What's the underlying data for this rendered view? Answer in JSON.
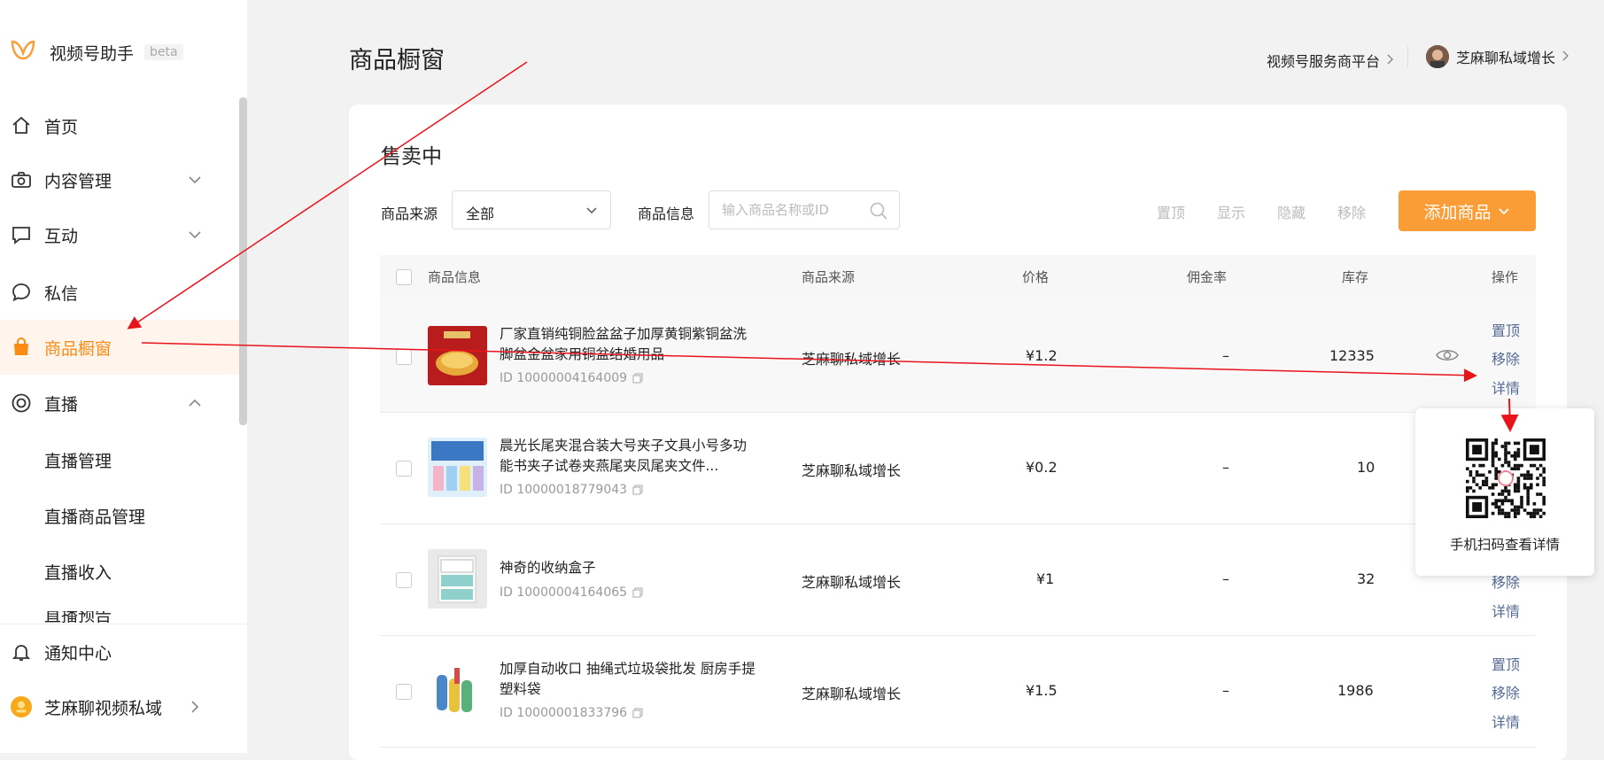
{
  "brand": {
    "name": "视频号助手",
    "badge": "beta"
  },
  "sidebar": {
    "items": [
      {
        "label": "首页",
        "icon": "home-icon"
      },
      {
        "label": "内容管理",
        "icon": "camera-icon"
      },
      {
        "label": "互动",
        "icon": "comment-icon"
      },
      {
        "label": "私信",
        "icon": "message-icon"
      },
      {
        "label": "商品橱窗",
        "icon": "shopping-bag-icon",
        "active": true
      },
      {
        "label": "直播",
        "icon": "live-icon"
      }
    ],
    "subitems": [
      "直播管理",
      "直播商品管理",
      "直播收入"
    ],
    "cut_item": "直播预告",
    "footer": {
      "notify": "通知中心",
      "account": "芝麻聊视频私域"
    }
  },
  "header": {
    "title": "商品橱窗",
    "service_platform": "视频号服务商平台",
    "account_name": "芝麻聊私域增长"
  },
  "section": {
    "title": "售卖中"
  },
  "filters": {
    "source_label": "商品来源",
    "source_value": "全部",
    "info_label": "商品信息",
    "search_placeholder": "输入商品名称或ID"
  },
  "toolbar": {
    "pin": "置顶",
    "show": "显示",
    "hide": "隐藏",
    "remove": "移除",
    "add": "添加商品"
  },
  "table": {
    "headers": {
      "info": "商品信息",
      "source": "商品来源",
      "price": "价格",
      "commission": "佣金率",
      "stock": "库存",
      "ops": "操作"
    },
    "rows": [
      {
        "name": "厂家直销纯铜脸盆盆子加厚黄铜紫铜盆洗脚盆金盆家用铜盆结婚用品",
        "id": "ID 10000004164009",
        "source": "芝麻聊私域增长",
        "price": "¥1.2",
        "commission": "–",
        "stock": "12335"
      },
      {
        "name": "晨光长尾夹混合装大号夹子文具小号多功能书夹子试卷夹燕尾夹凤尾夹文件...",
        "id": "ID 10000018779043",
        "source": "芝麻聊私域增长",
        "price": "¥0.2",
        "commission": "–",
        "stock": "10"
      },
      {
        "name": "神奇的收纳盒子",
        "id": "ID 10000004164065",
        "source": "芝麻聊私域增长",
        "price": "¥1",
        "commission": "–",
        "stock": "32"
      },
      {
        "name": "加厚自动收口 抽绳式垃圾袋批发 厨房手提塑料袋",
        "id": "ID 10000001833796",
        "source": "芝麻聊私域增长",
        "price": "¥1.5",
        "commission": "–",
        "stock": "1986"
      }
    ],
    "actions": {
      "pin": "置顶",
      "remove": "移除",
      "detail": "详情"
    }
  },
  "popover": {
    "caption": "手机扫码查看详情"
  },
  "colors": {
    "accent": "#fa8c16",
    "button": "#fa9d37",
    "link": "#576b95",
    "annotation": "#e8141b"
  }
}
